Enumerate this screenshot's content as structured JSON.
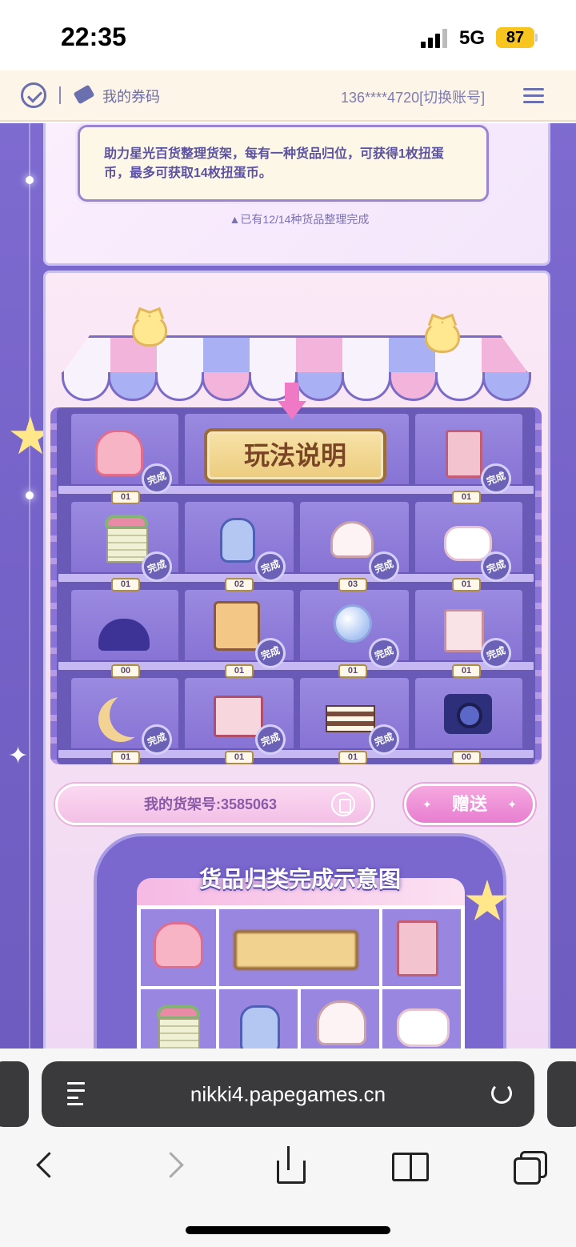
{
  "status_bar": {
    "time": "22:35",
    "network": "5G",
    "battery": "87"
  },
  "header": {
    "coupon_label": "我的券码",
    "account": "136****4720[切换账号]"
  },
  "intro": {
    "text": "助力星光百货整理货架，每有一种货品归位，可获得1枚扭蛋币，最多可获取14枚扭蛋币。",
    "progress": "▲已有12/14种货品整理完成"
  },
  "shelf": {
    "rules_label": "玩法说明",
    "done_label": "完成",
    "row1": [
      "01",
      "",
      "",
      "01"
    ],
    "row2": [
      "01",
      "02",
      "03",
      "01"
    ],
    "row3": [
      "00",
      "01",
      "01",
      "01"
    ],
    "row4": [
      "01",
      "01",
      "01",
      "00"
    ],
    "shelf_id_label": "我的货架号:3585063",
    "gift_label": "赠送"
  },
  "sample": {
    "title": "货品归类完成示意图"
  },
  "browser": {
    "url": "nikki4.papegames.cn"
  }
}
